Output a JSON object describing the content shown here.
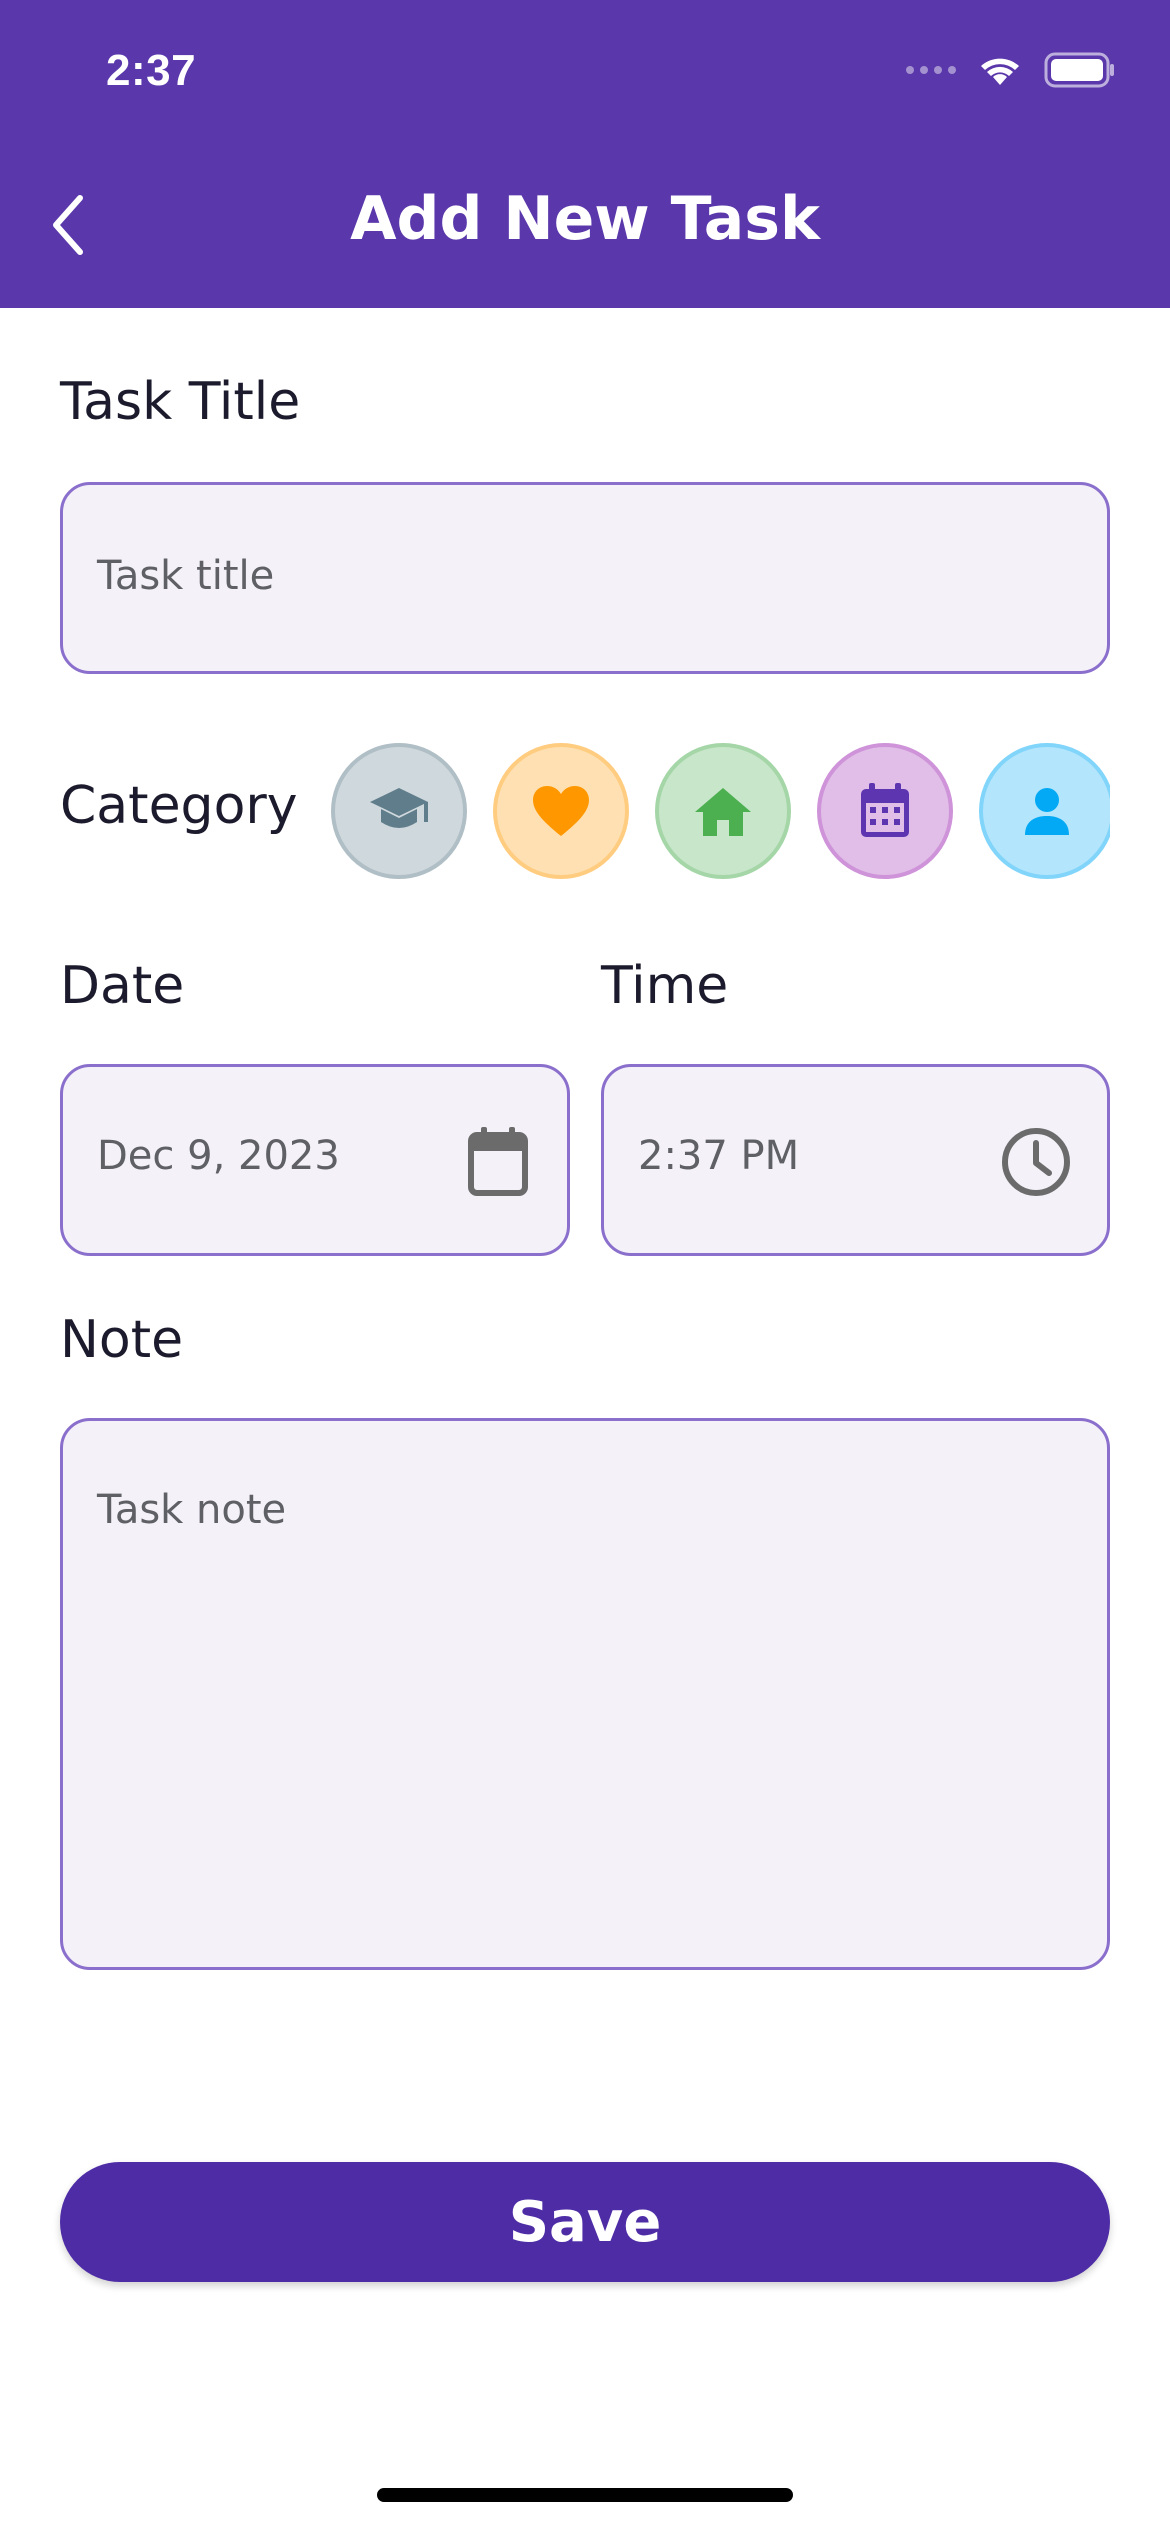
{
  "status_bar": {
    "time": "2:37"
  },
  "header": {
    "title": "Add New Task"
  },
  "form": {
    "title_label": "Task Title",
    "title_placeholder": "Task title",
    "category_label": "Category",
    "categories": [
      {
        "icon": "graduation-cap-icon",
        "bg": "#CFD8DC",
        "border": "#B0BEC5",
        "color": "#607D8B"
      },
      {
        "icon": "heart-icon",
        "bg": "#FFE0B2",
        "border": "#FFCC80",
        "color": "#FF9800"
      },
      {
        "icon": "home-icon",
        "bg": "#C8E6C9",
        "border": "#A5D6A7",
        "color": "#4CAF50"
      },
      {
        "icon": "calendar-icon",
        "bg": "#E1BEE7",
        "border": "#CE93D8",
        "color": "#5E35B1"
      },
      {
        "icon": "person-icon",
        "bg": "#B3E5FC",
        "border": "#81D4FA",
        "color": "#03A9F4"
      }
    ],
    "date_label": "Date",
    "date_value": "Dec 9, 2023",
    "time_label": "Time",
    "time_value": "2:37 PM",
    "note_label": "Note",
    "note_placeholder": "Task note"
  },
  "actions": {
    "save_label": "Save"
  },
  "colors": {
    "header": "#5A37AA",
    "accent": "#4E2CA6",
    "field_bg": "#F4F1F9",
    "field_border": "#8B6FCC"
  }
}
